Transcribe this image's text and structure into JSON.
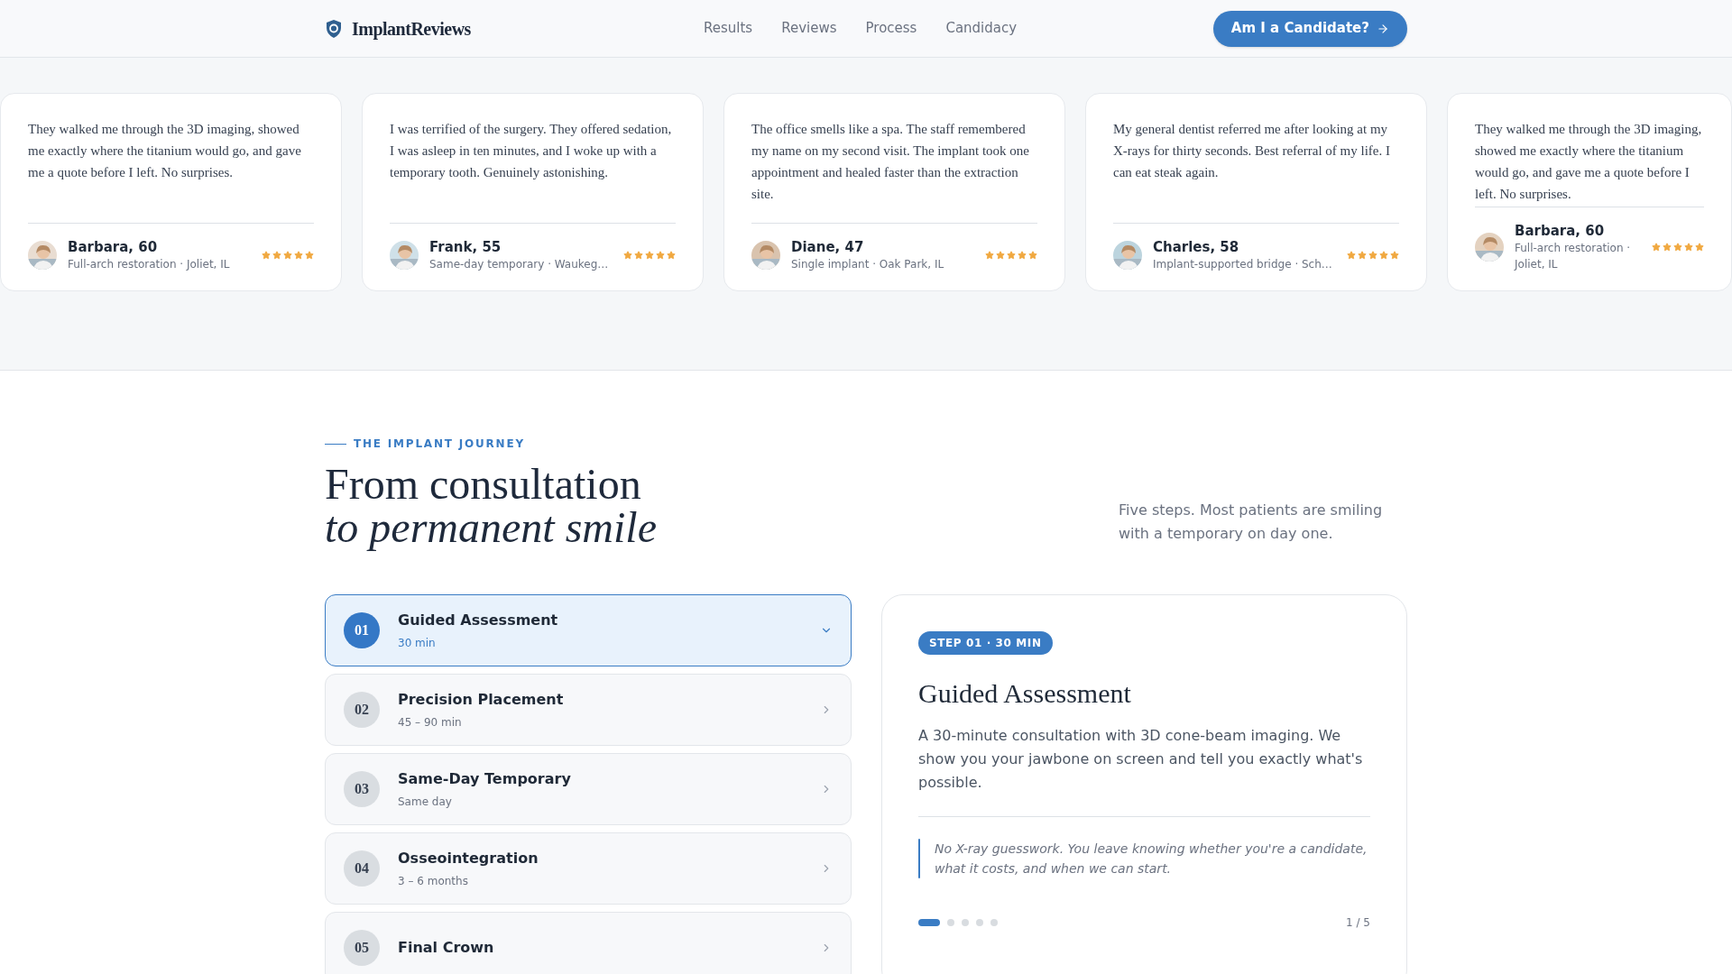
{
  "header": {
    "brand": "ImplantReviews",
    "nav": [
      "Results",
      "Reviews",
      "Process",
      "Candidacy"
    ],
    "cta": "Am I a Candidate?"
  },
  "testimonials": [
    {
      "quote": "They walked me through the 3D imaging, showed me exactly where the titanium would go, and gave me a quote before I left. No surprises.",
      "name": "Barbara, 60",
      "detail": "Full-arch restoration · Joliet, IL",
      "stars": 5
    },
    {
      "quote": "I was terrified of the surgery. They offered sedation, I was asleep in ten minutes, and I woke up with a temporary tooth. Genuinely astonishing.",
      "name": "Frank, 55",
      "detail": "Same-day temporary · Waukeg…",
      "stars": 5
    },
    {
      "quote": "The office smells like a spa. The staff remembered my name on my second visit. The implant took one appointment and healed faster than the extraction site.",
      "name": "Diane, 47",
      "detail": "Single implant · Oak Park, IL",
      "stars": 5
    },
    {
      "quote": "My general dentist referred me after looking at my X-rays for thirty seconds. Best referral of my life. I can eat steak again.",
      "name": "Charles, 58",
      "detail": "Implant-supported bridge · Sch…",
      "stars": 5
    },
    {
      "quote": "They walked me through the 3D imaging, showed me exactly where the titanium would go, and gave me a quote before I left. No surprises.",
      "name": "Barbara, 60",
      "detail": "Full-arch restoration · Joliet, IL",
      "stars": 5
    }
  ],
  "journey": {
    "eyebrow": "THE IMPLANT JOURNEY",
    "title": "From consultation",
    "title_italic": "to permanent smile",
    "intro": "Five steps. Most patients are smiling with a temporary on day one.",
    "steps": [
      {
        "number": "01",
        "title": "Guided Assessment",
        "duration": "30 min",
        "selected": true
      },
      {
        "number": "02",
        "title": "Precision Placement",
        "duration": "45 – 90 min",
        "selected": false
      },
      {
        "number": "03",
        "title": "Same-Day Temporary",
        "duration": "Same day",
        "selected": false
      },
      {
        "number": "04",
        "title": "Osseointegration",
        "duration": "3 – 6 months",
        "selected": false
      },
      {
        "number": "05",
        "title": "Final Crown",
        "selected": false
      }
    ],
    "detail": {
      "badge": "STEP 01 · 30 MIN",
      "title": "Guided Assessment",
      "description": "A 30-minute consultation with 3D cone-beam imaging. We show you your jawbone on screen and tell you exactly what's possible.",
      "note": "No X-ray guesswork. You leave knowing whether you're a candidate, what it costs, and when we can start.",
      "dots": [
        {
          "selected": true
        },
        {
          "selected": false
        },
        {
          "selected": false
        },
        {
          "selected": false
        },
        {
          "selected": false
        }
      ],
      "counter": "1 / 5"
    }
  }
}
